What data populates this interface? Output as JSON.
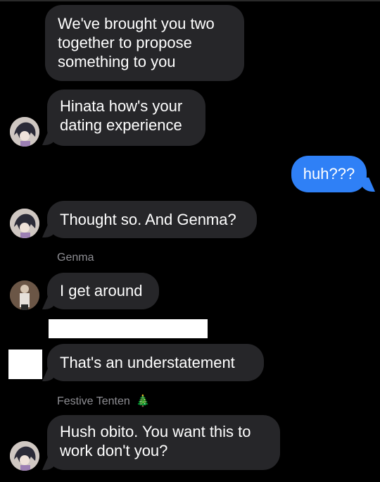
{
  "conversation": {
    "messages": [
      {
        "text": "We've brought you two\ntogether to propose\nsomething to you"
      },
      {
        "text": "Hinata how's your\ndating experience"
      },
      {
        "text": "huh???"
      },
      {
        "text": "Thought so. And Genma?"
      },
      {
        "sender": "Genma",
        "text": "I get around"
      },
      {
        "text": "That's an understatement"
      },
      {
        "sender": "Festive Tenten",
        "sender_emoji": "🎄",
        "text": "Hush obito. You want this to\nwork don't you?"
      }
    ]
  },
  "colors": {
    "background": "#000000",
    "incoming_bubble": "#262629",
    "outgoing_bubble": "#2f80f6",
    "sender_label": "#8e8e93"
  }
}
